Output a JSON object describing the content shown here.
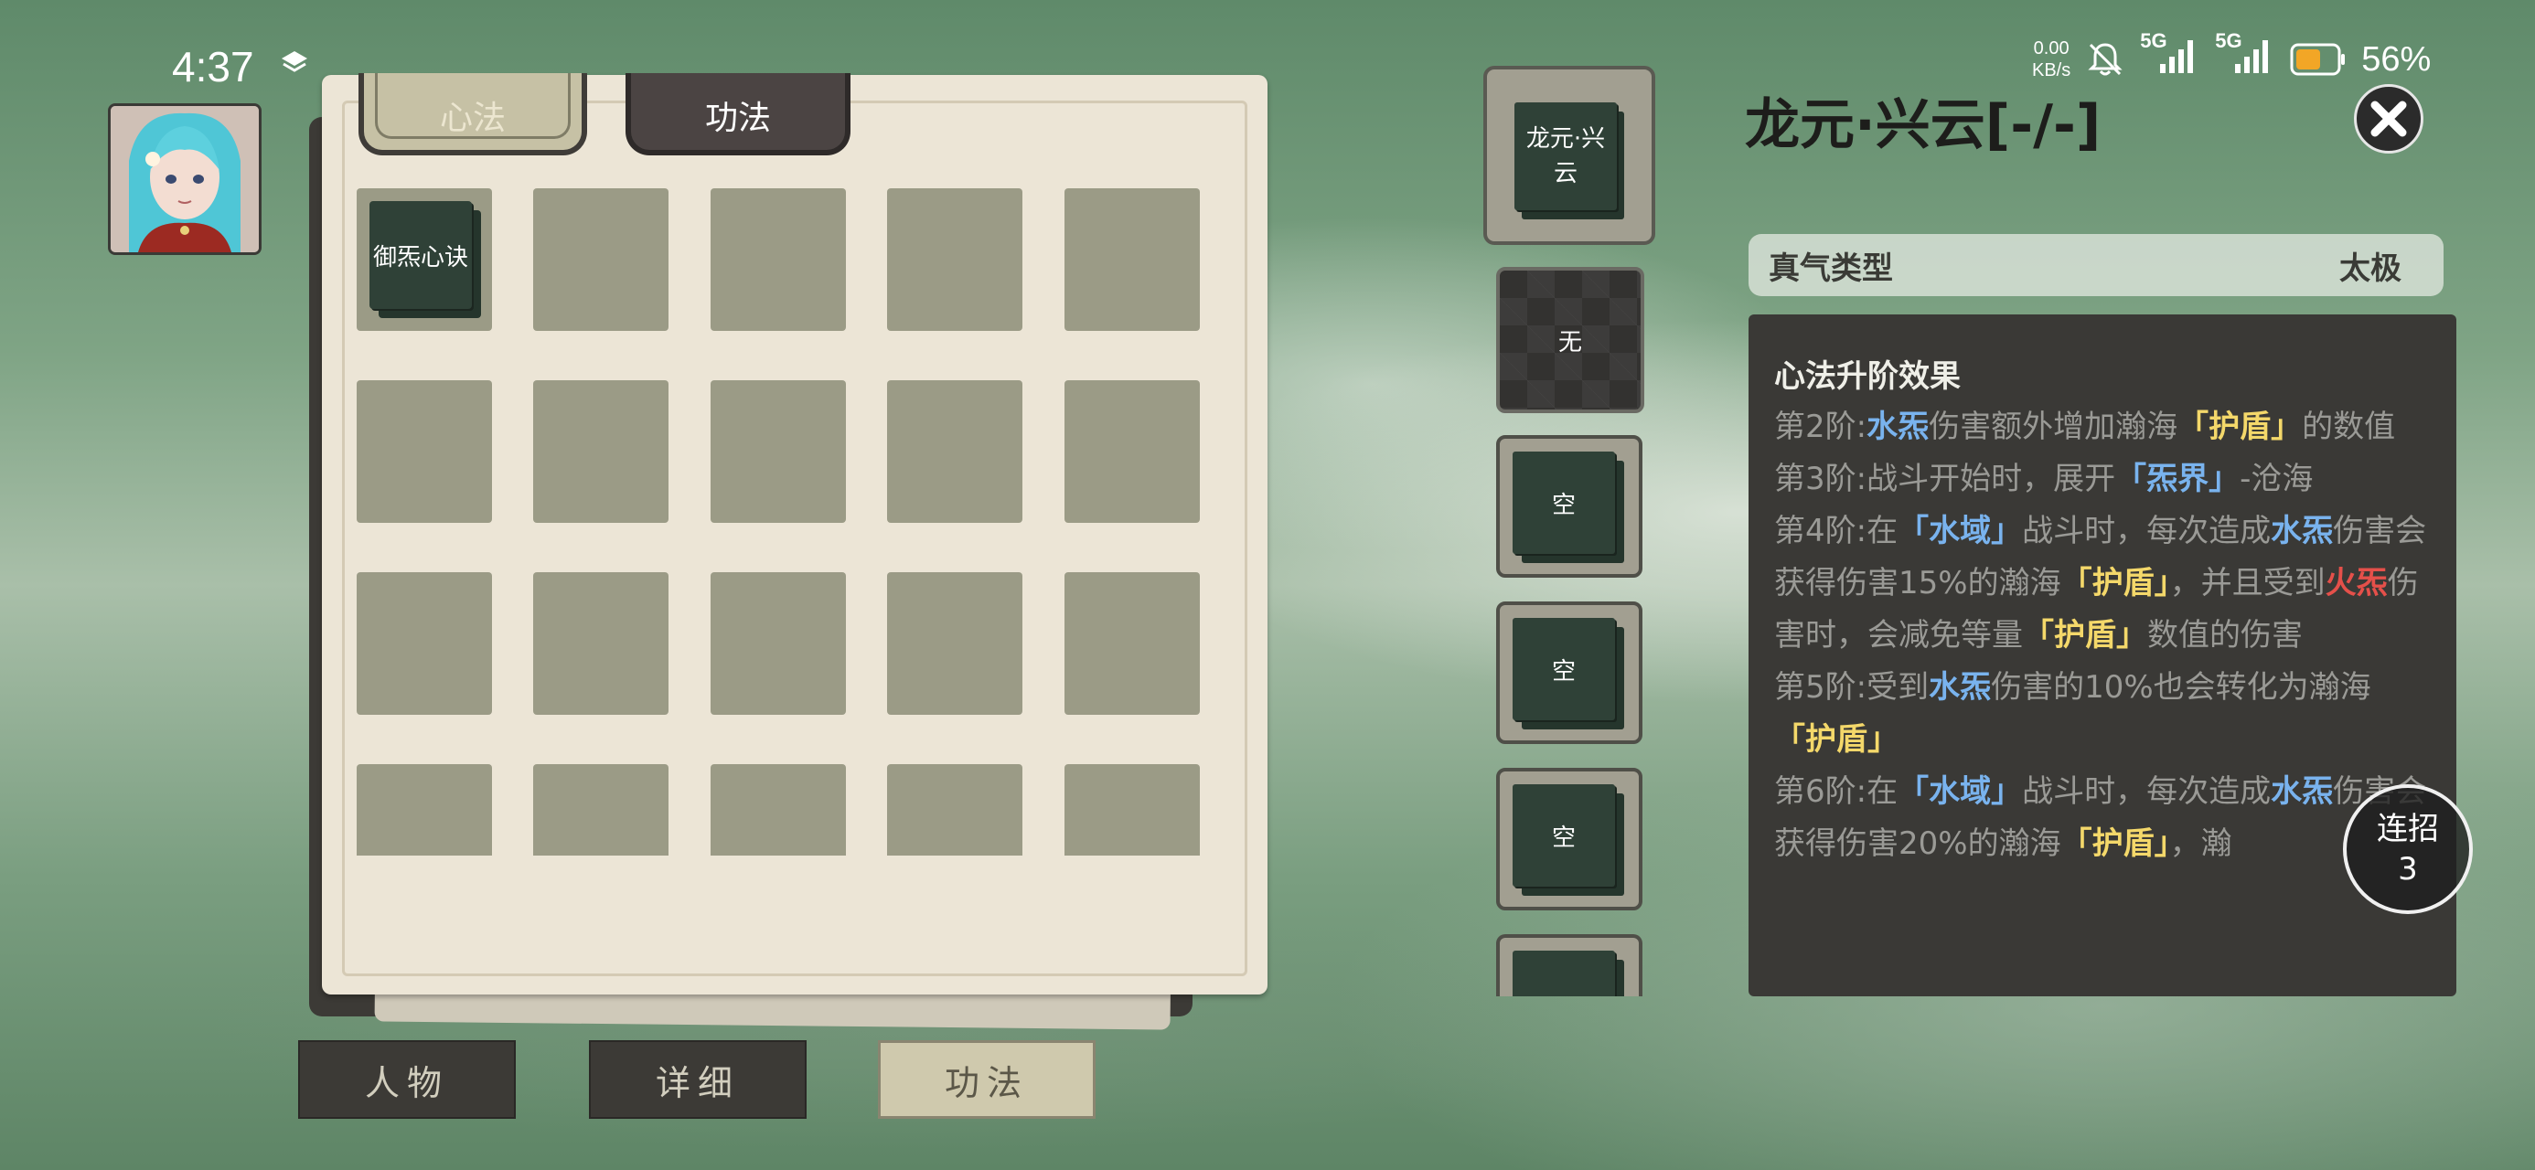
{
  "status_bar": {
    "time": "4:37",
    "net_speed_value": "0.00",
    "net_speed_unit": "KB/s",
    "signal1": "5G",
    "signal2": "5G",
    "battery": "56%"
  },
  "left_panel": {
    "tabs": [
      {
        "label": "心法",
        "active": true
      },
      {
        "label": "功法",
        "active": false
      }
    ],
    "grid_first_item": "御炁心诀"
  },
  "bottom_nav": [
    {
      "label": "人物"
    },
    {
      "label": "详细"
    },
    {
      "label": "功法",
      "active": true
    }
  ],
  "middle_column": {
    "top_card": "龙元·兴云",
    "none_slot": "无",
    "slots": [
      "空",
      "空",
      "空"
    ]
  },
  "right_panel": {
    "title": "龙元·兴云[-/-]",
    "qi_type_label": "真气类型",
    "qi_type_value": "太极",
    "effects_header": "心法升阶效果",
    "combo_label": "连招",
    "combo_value": "3"
  },
  "colors": {
    "water_blue": "#79b3ee",
    "shield_yellow": "#f4d86a",
    "fire_red": "#e5504a"
  }
}
